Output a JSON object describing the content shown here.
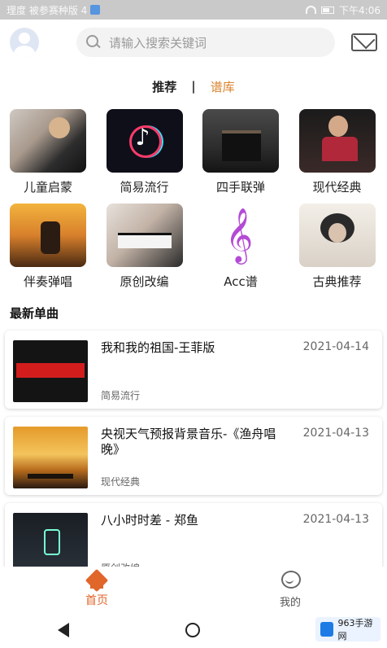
{
  "status_bar": {
    "left_text": "理度 被参赛种版 4",
    "right_text": "下午4:06"
  },
  "header": {
    "search_placeholder": "请输入搜索关键词"
  },
  "tabs": {
    "recommend": "推荐",
    "separator": "|",
    "library": "谱库"
  },
  "categories": [
    {
      "label": "儿童启蒙"
    },
    {
      "label": "简易流行"
    },
    {
      "label": "四手联弹"
    },
    {
      "label": "现代经典"
    },
    {
      "label": "伴奏弹唱"
    },
    {
      "label": "原创改编"
    },
    {
      "label": "Acc谱"
    },
    {
      "label": "古典推荐"
    }
  ],
  "latest": {
    "section_title": "最新单曲",
    "items": [
      {
        "title": "我和我的祖国-王菲版",
        "category": "简易流行",
        "date": "2021-04-14"
      },
      {
        "title": "央视天气预报背景音乐-《渔舟唱晚》",
        "category": "现代经典",
        "date": "2021-04-13"
      },
      {
        "title": "八小时时差 - 郑鱼",
        "category": "原创改编",
        "date": "2021-04-13"
      }
    ]
  },
  "bottom_nav": {
    "home": "首页",
    "me": "我的"
  },
  "watermark": {
    "text": "963手游网"
  },
  "colors": {
    "accent": "#e0662a",
    "tab_active": "#d9822b"
  },
  "icons": {
    "search": "search-icon",
    "mail": "mail-icon",
    "home": "home-icon",
    "me": "chat-smile-icon"
  }
}
